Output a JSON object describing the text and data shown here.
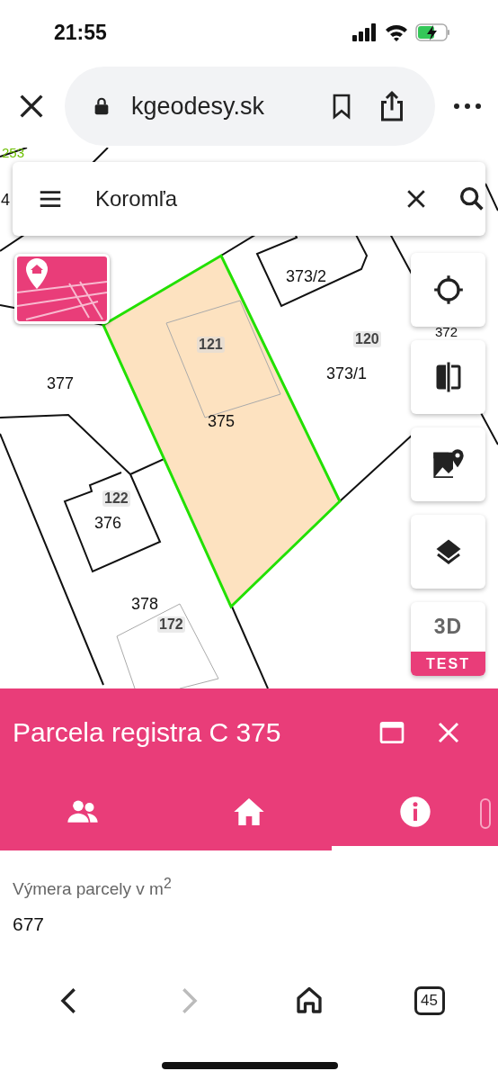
{
  "status_bar": {
    "time": "21:55"
  },
  "browser": {
    "url": "kgeodesy.sk"
  },
  "search": {
    "value": "Koromľa"
  },
  "map_labels": [
    {
      "text": "253",
      "kind": "edge"
    },
    {
      "text": "4",
      "kind": "parcel"
    },
    {
      "text": "373/2",
      "kind": "parcel"
    },
    {
      "text": "372",
      "kind": "parcel"
    },
    {
      "text": "121",
      "kind": "building"
    },
    {
      "text": "120",
      "kind": "building"
    },
    {
      "text": "377",
      "kind": "parcel"
    },
    {
      "text": "373/1",
      "kind": "parcel"
    },
    {
      "text": "375",
      "kind": "parcel"
    },
    {
      "text": "122",
      "kind": "building"
    },
    {
      "text": "376",
      "kind": "parcel"
    },
    {
      "text": "378",
      "kind": "parcel"
    },
    {
      "text": "172",
      "kind": "building"
    }
  ],
  "map_buttons": [
    {
      "kind": "locate"
    },
    {
      "kind": "compare"
    },
    {
      "kind": "photo"
    },
    {
      "kind": "layers"
    },
    {
      "kind": "threed",
      "label": "3D",
      "badge": "TEST"
    }
  ],
  "panel": {
    "title": "Parcela registra C 375",
    "tabs": [
      {
        "kind": "owners",
        "selected": false
      },
      {
        "kind": "building",
        "selected": false
      },
      {
        "kind": "info",
        "selected": true
      }
    ],
    "field_label": "Výmera parcely v m$^{2}$",
    "field_value": "677"
  },
  "bottom_bar": {
    "back_disabled": false,
    "forward_disabled": true,
    "tab_count": "45"
  }
}
